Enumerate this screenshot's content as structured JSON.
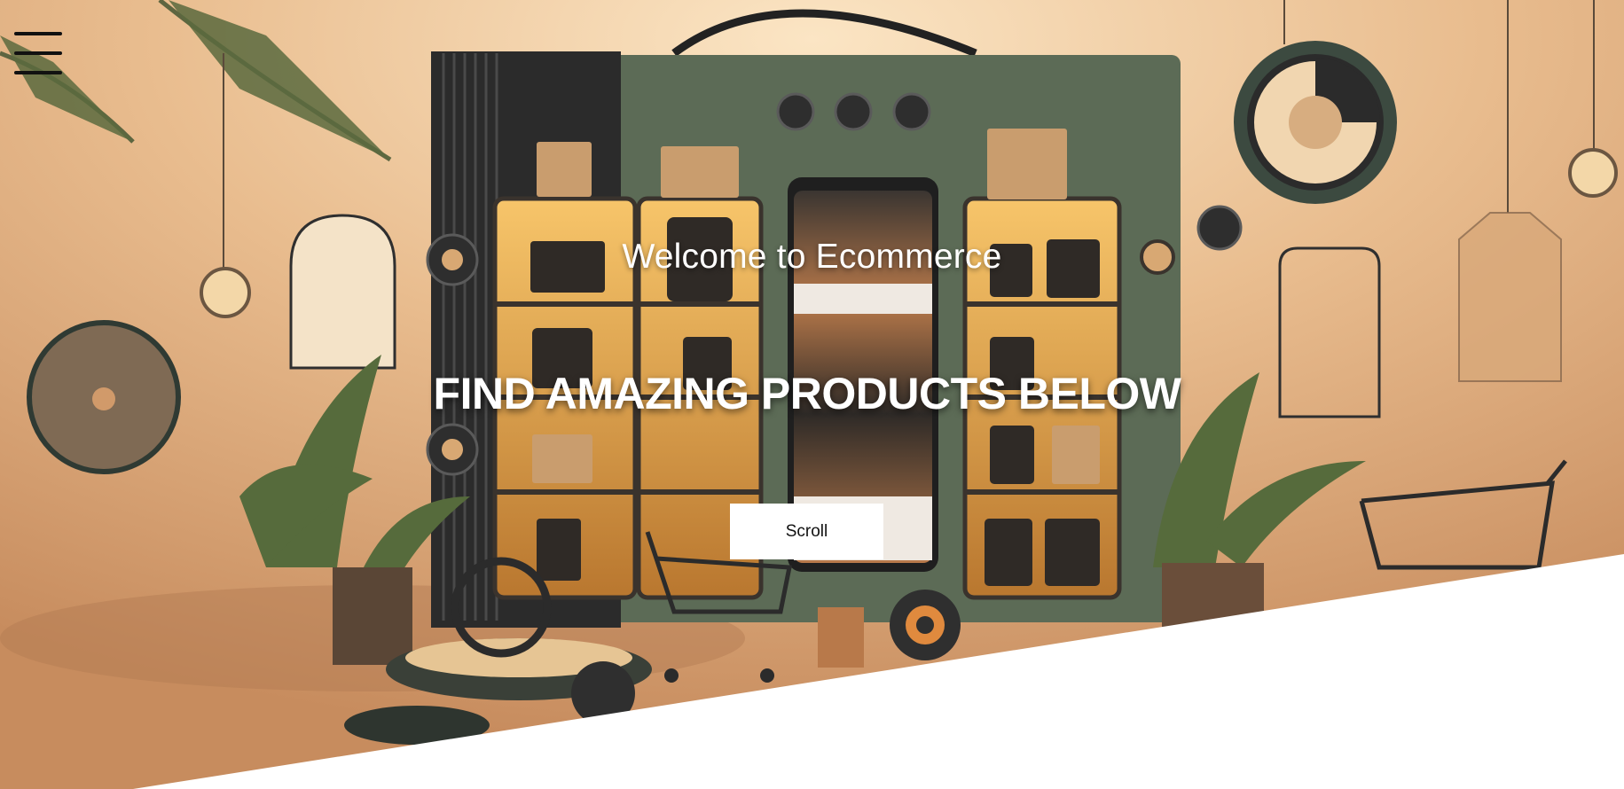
{
  "hero": {
    "welcome_text": "Welcome to Ecommerce",
    "tagline": "FIND AMAZING PRODUCTS BELOW",
    "scroll_label": "Scroll"
  },
  "nav": {
    "menu_icon": "hamburger-menu-icon"
  },
  "colors": {
    "background_warm": "#d9a97c",
    "panel_green": "#5c6b56",
    "text": "#ffffff",
    "button_bg": "#ffffff",
    "button_text": "#111111"
  }
}
